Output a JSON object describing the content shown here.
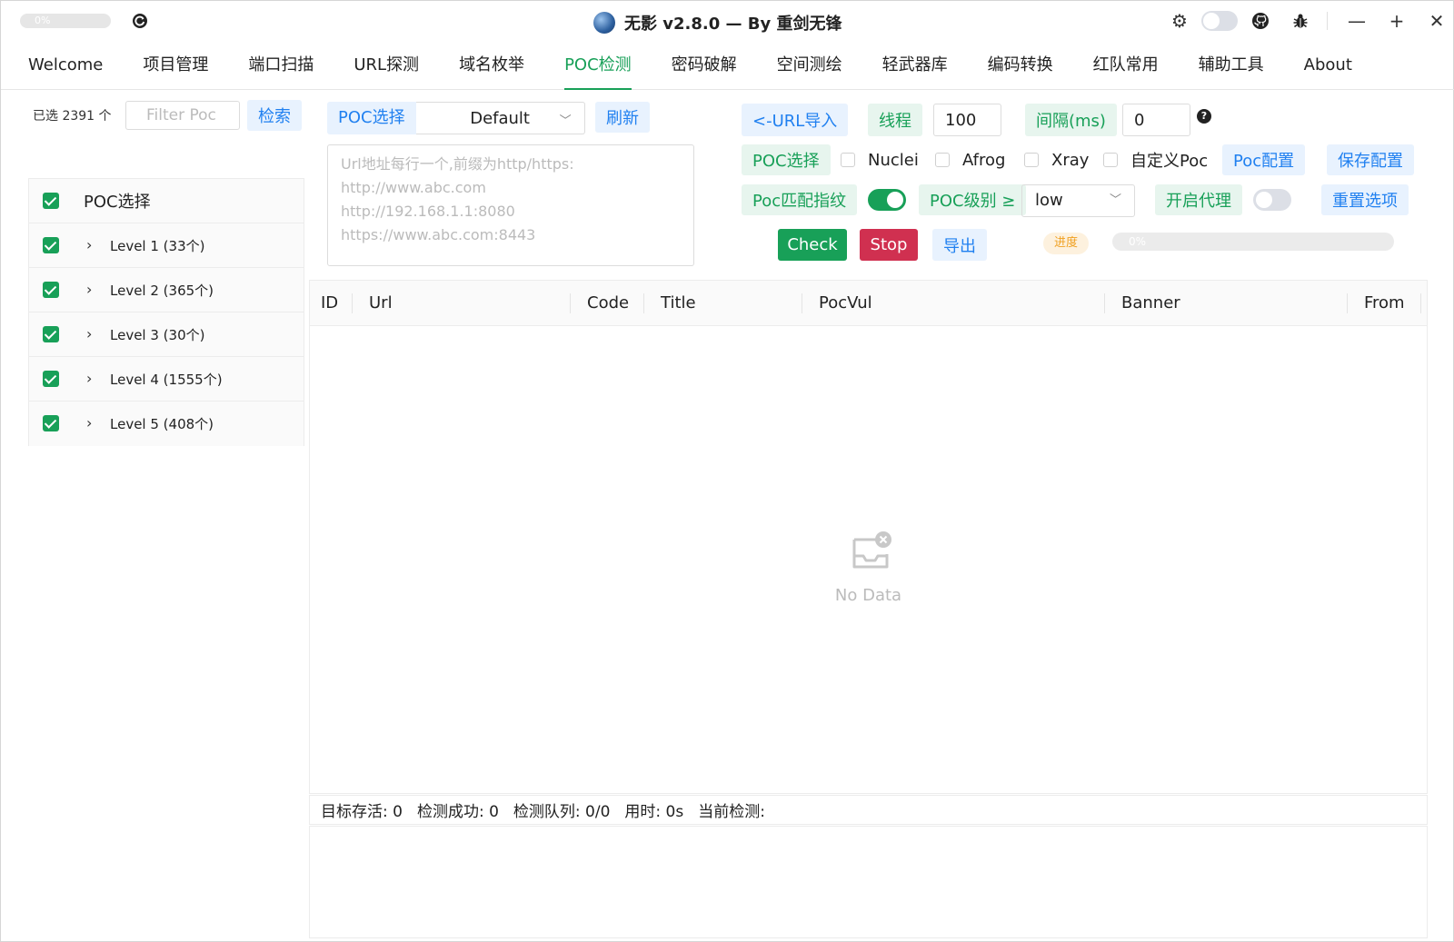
{
  "titlebar": {
    "progress_text": "0%",
    "title": "无影 v2.8.0 — By 重剑无锋",
    "icons": [
      "reload-icon",
      "gear-icon",
      "theme-toggle",
      "github-icon",
      "bug-icon",
      "minimize-icon",
      "maximize-icon",
      "close-icon"
    ]
  },
  "tabs": [
    {
      "label": "Welcome"
    },
    {
      "label": "项目管理"
    },
    {
      "label": "端口扫描"
    },
    {
      "label": "URL探测"
    },
    {
      "label": "域名枚举"
    },
    {
      "label": "POC检测",
      "active": true
    },
    {
      "label": "密码破解"
    },
    {
      "label": "空间测绘"
    },
    {
      "label": "轻武器库"
    },
    {
      "label": "编码转换"
    },
    {
      "label": "红队常用"
    },
    {
      "label": "辅助工具"
    },
    {
      "label": "About"
    }
  ],
  "left": {
    "selected_count": "已选 2391 个",
    "filter_placeholder": "Filter Poc",
    "search_label": "检索",
    "tree_header": "POC选择",
    "levels": [
      {
        "label": "Level 1 (33个)"
      },
      {
        "label": "Level 2 (365个)"
      },
      {
        "label": "Level 3 (30个)"
      },
      {
        "label": "Level 4 (1555个)"
      },
      {
        "label": "Level 5 (408个)"
      }
    ]
  },
  "middle": {
    "poc_select_label": "POC选择",
    "poc_select_value": "Default",
    "refresh_label": "刷新",
    "url_placeholder": "Url地址每行一个,前缀为http/https:\nhttp://www.abc.com\nhttp://192.168.1.1:8080\nhttps://www.abc.com:8443"
  },
  "right": {
    "url_import_label": "<-URL导入",
    "threads_label": "线程",
    "threads_value": "100",
    "interval_label": "间隔(ms)",
    "interval_value": "0",
    "help_glyph": "?",
    "poc_choice_label": "POC选择",
    "engines": [
      {
        "label": "Nuclei",
        "checked": false
      },
      {
        "label": "Afrog",
        "checked": false
      },
      {
        "label": "Xray",
        "checked": false
      },
      {
        "label": "自定义Poc",
        "checked": false
      }
    ],
    "poc_config_label": "Poc配置",
    "save_config_label": "保存配置",
    "fingerprint_label": "Poc匹配指纹",
    "fingerprint_enabled": true,
    "level_label": "POC级别 ≥",
    "level_value": "low",
    "proxy_label": "开启代理",
    "proxy_enabled": false,
    "reset_label": "重置选项",
    "check_label": "Check",
    "stop_label": "Stop",
    "export_label": "导出",
    "progress_tag": "进度",
    "progress_text": "0%",
    "progress_value": 0
  },
  "table": {
    "columns": [
      "ID",
      "Url",
      "Code",
      "Title",
      "PocVul",
      "Banner",
      "From"
    ],
    "empty_text": "No Data"
  },
  "status": {
    "alive": "目标存活: 0",
    "success": "检测成功: 0",
    "queue": "检测队列: 0/0",
    "elapsed": "用时: 0s",
    "current": "当前检测:"
  },
  "colors": {
    "primary": "#18a058",
    "info": "#2080f0",
    "danger": "#d03050",
    "warning": "#f0a020"
  }
}
